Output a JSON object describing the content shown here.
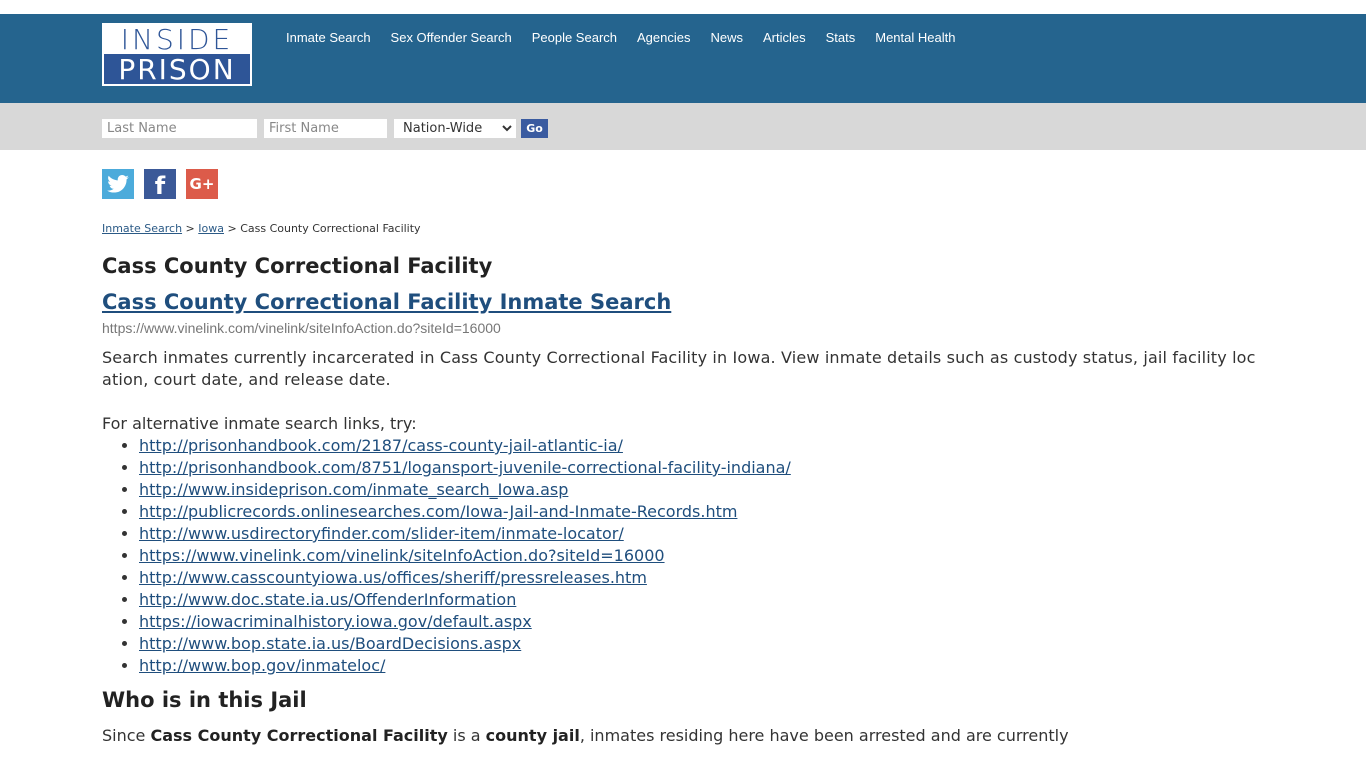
{
  "site": {
    "logo_line1": "INSIDE",
    "logo_line2": "PRISON",
    "colors": {
      "header": "#25648e",
      "search_bar": "#d8d8d8",
      "link": "#1f4e7d",
      "go_button": "#3a5ba0"
    }
  },
  "nav": {
    "items": [
      {
        "label": "Inmate Search"
      },
      {
        "label": "Sex Offender Search"
      },
      {
        "label": "People Search"
      },
      {
        "label": "Agencies"
      },
      {
        "label": "News"
      },
      {
        "label": "Articles"
      },
      {
        "label": "Stats"
      },
      {
        "label": "Mental Health"
      }
    ]
  },
  "search": {
    "last_name_placeholder": "Last Name",
    "first_name_placeholder": "First Name",
    "scope_selected": "Nation-Wide",
    "go_label": "Go"
  },
  "social": {
    "twitter": "twitter-icon",
    "facebook": "facebook-icon",
    "googleplus": "google-plus-icon",
    "facebook_glyph": "f",
    "googleplus_glyph": "G+"
  },
  "breadcrumb": {
    "items": [
      "Inmate Search",
      "Iowa"
    ],
    "separator": ">",
    "current": "Cass County Correctional Facility"
  },
  "main": {
    "title": "Cass County Correctional Facility",
    "search_link": "Cass County Correctional Facility Inmate Search",
    "search_url": "https://www.vinelink.com/vinelink/siteInfoAction.do?siteId=16000",
    "description": "Search inmates currently incarcerated in Cass County Correctional Facility in Iowa. View inmate details such as custody status, jail facility location, court date, and release date.",
    "alt_intro": "For alternative inmate search links, try:",
    "alt_links": [
      "http://prisonhandbook.com/2187/cass-county-jail-atlantic-ia/",
      "http://prisonhandbook.com/8751/logansport-juvenile-correctional-facility-indiana/",
      "http://www.insideprison.com/inmate_search_Iowa.asp",
      "http://publicrecords.onlinesearches.com/Iowa-Jail-and-Inmate-Records.htm",
      "http://www.usdirectoryfinder.com/slider-item/inmate-locator/",
      "https://www.vinelink.com/vinelink/siteInfoAction.do?siteId=16000",
      "http://www.casscountyiowa.us/offices/sheriff/pressreleases.htm",
      "http://www.doc.state.ia.us/OffenderInformation",
      "https://iowacriminalhistory.iowa.gov/default.aspx",
      "http://www.bop.state.ia.us/BoardDecisions.aspx",
      "http://www.bop.gov/inmateloc/"
    ],
    "who_heading": "Who is in this Jail",
    "since": {
      "p1": "Since ",
      "b1": "Cass County Correctional Facility",
      "p2": " is a ",
      "b2": "county jail",
      "p3": ", inmates residing here have been arrested and are currently"
    }
  }
}
